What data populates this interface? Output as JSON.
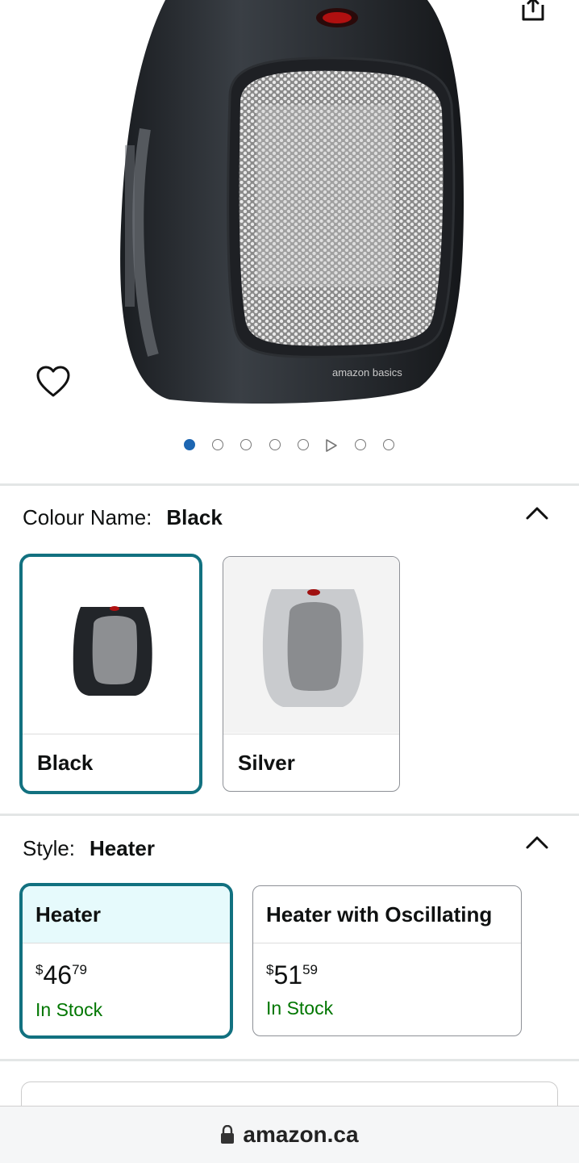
{
  "gallery": {
    "brand_text": "amazon basics",
    "dots_total": 8,
    "active_dot": 0,
    "video_dot": 5
  },
  "colour": {
    "label": "Colour Name:",
    "selected": "Black",
    "options": [
      {
        "name": "Black"
      },
      {
        "name": "Silver"
      }
    ]
  },
  "style": {
    "label": "Style:",
    "selected": "Heater",
    "options": [
      {
        "name": "Heater",
        "price_symbol": "$",
        "price_whole": "46",
        "price_fraction": "79",
        "availability": "In Stock"
      },
      {
        "name": "Heater with Oscillating",
        "price_symbol": "$",
        "price_whole": "51",
        "price_fraction": "59",
        "availability": "In Stock"
      }
    ]
  },
  "browser": {
    "url": "amazon.ca"
  },
  "colors": {
    "accent": "#127180",
    "selected_bg": "#e6fafc",
    "in_stock": "#007600",
    "active_dot": "#1d66b2"
  }
}
